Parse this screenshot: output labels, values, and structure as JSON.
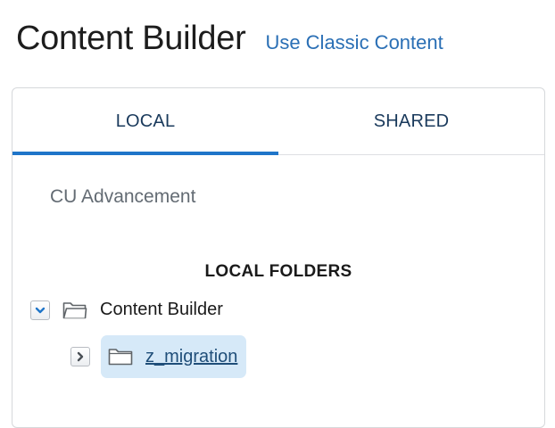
{
  "header": {
    "title": "Content Builder",
    "classic_link": "Use Classic Content"
  },
  "tabs": [
    {
      "label": "LOCAL",
      "active": true
    },
    {
      "label": "SHARED",
      "active": false
    }
  ],
  "business_unit": "CU Advancement",
  "folders": {
    "heading": "LOCAL FOLDERS",
    "root": {
      "label": "Content Builder",
      "expanded": true,
      "toggle_icon": "chevron-down-icon",
      "icon": "folder-open-icon"
    },
    "children": [
      {
        "label": "z_migration",
        "expanded": false,
        "selected": true,
        "toggle_icon": "chevron-right-icon",
        "icon": "folder-icon"
      }
    ]
  },
  "colors": {
    "accent": "#1f75c9",
    "link": "#2a6fb5",
    "selection": "#d6e9f8"
  }
}
